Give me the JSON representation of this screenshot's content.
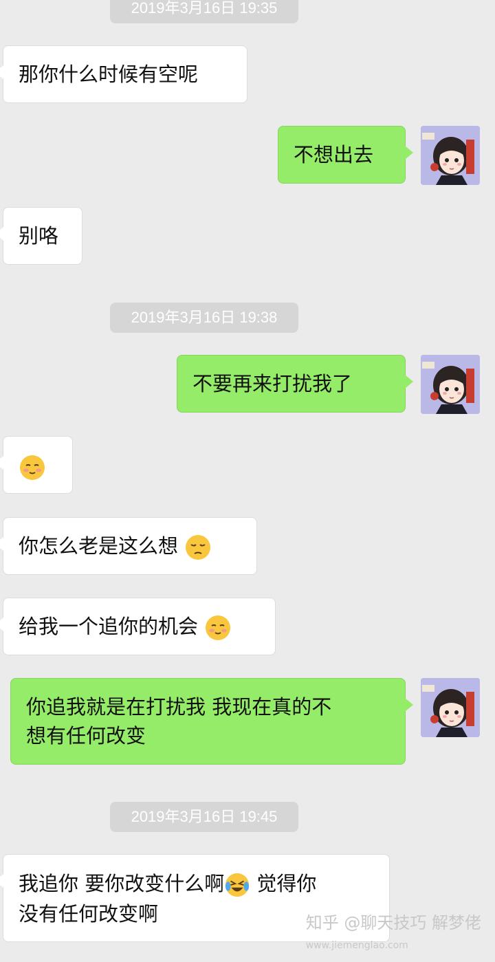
{
  "timestamps": [
    "2019年3月16日 19:35",
    "2019年3月16日 19:38",
    "2019年3月16日 19:45"
  ],
  "messages": {
    "m1": "那你什么时候有空呢",
    "m2": "不想出去",
    "m3": "别咯",
    "m4": "不要再来打扰我了",
    "m6": "你怎么老是这么想",
    "m7": "给我一个追你的机会",
    "m8a": "你追我就是在打扰我 我现在真的不",
    "m8b": "想有任何改变",
    "m9a": "我追你 要你改变什么啊",
    "m9b": " 觉得你",
    "m9c": "没有任何改变啊"
  },
  "emojis": {
    "m5": "shy-smile-emoji",
    "m6": "pensive-emoji",
    "m7": "shy-smile-emoji",
    "m9": "crying-laughing-emoji"
  },
  "watermark": {
    "text": "知乎 @聊天技巧 解梦佬",
    "site": "www.jiemenglao.com"
  },
  "colors": {
    "background": "#ebebeb",
    "outgoing_bubble": "#95ec69",
    "incoming_bubble": "#ffffff",
    "timestamp_pill": "#d6d6d6"
  }
}
